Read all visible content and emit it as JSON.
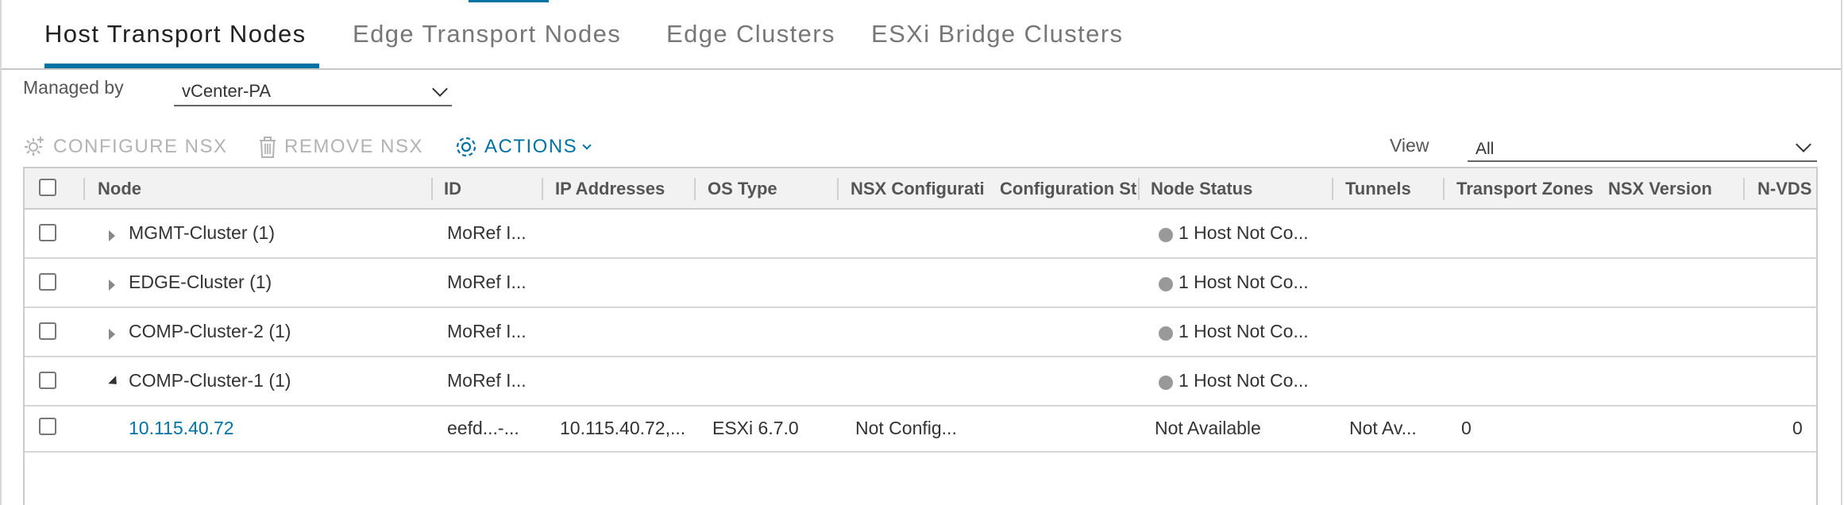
{
  "tabs": [
    {
      "label": "Host Transport Nodes",
      "active": true
    },
    {
      "label": "Edge Transport Nodes",
      "active": false
    },
    {
      "label": "Edge Clusters",
      "active": false
    },
    {
      "label": "ESXi Bridge Clusters",
      "active": false
    }
  ],
  "managed_by": {
    "label": "Managed by",
    "value": "vCenter-PA"
  },
  "toolbar": {
    "configure_label": "CONFIGURE NSX",
    "remove_label": "REMOVE NSX",
    "actions_label": "ACTIONS"
  },
  "view": {
    "label": "View",
    "value": "All"
  },
  "colors": {
    "accent": "#0072a3",
    "disabled": "#b3b3b3",
    "status_gray": "#999999"
  },
  "table": {
    "columns": [
      "Node",
      "ID",
      "IP Addresses",
      "OS Type",
      "NSX Configurati",
      "Configuration St",
      "Node Status",
      "Tunnels",
      "Transport Zones",
      "NSX Version",
      "N-VDS"
    ],
    "rows": [
      {
        "node": "MGMT-Cluster (1)",
        "id": "MoRef I...",
        "ip": "",
        "os": "",
        "nsx_config": "",
        "config_state": "",
        "status": "1 Host Not Co...",
        "tunnels": "",
        "zones": "",
        "version": "",
        "nvds": "",
        "expanded": false
      },
      {
        "node": "EDGE-Cluster (1)",
        "id": "MoRef I...",
        "ip": "",
        "os": "",
        "nsx_config": "",
        "config_state": "",
        "status": "1 Host Not Co...",
        "tunnels": "",
        "zones": "",
        "version": "",
        "nvds": "",
        "expanded": false
      },
      {
        "node": "COMP-Cluster-2 (1)",
        "id": "MoRef I...",
        "ip": "",
        "os": "",
        "nsx_config": "",
        "config_state": "",
        "status": "1 Host Not Co...",
        "tunnels": "",
        "zones": "",
        "version": "",
        "nvds": "",
        "expanded": false
      },
      {
        "node": "COMP-Cluster-1 (1)",
        "id": "MoRef I...",
        "ip": "",
        "os": "",
        "nsx_config": "",
        "config_state": "",
        "status": "1 Host Not Co...",
        "tunnels": "",
        "zones": "",
        "version": "",
        "nvds": "",
        "expanded": true
      },
      {
        "node": "10.115.40.72",
        "id": "eefd...-...",
        "ip": "10.115.40.72,...",
        "os": "ESXi 6.7.0",
        "nsx_config": "Not Config...",
        "config_state": "",
        "status": "Not Available",
        "tunnels": "Not Av...",
        "zones": "0",
        "version": "",
        "nvds": "0"
      }
    ]
  }
}
